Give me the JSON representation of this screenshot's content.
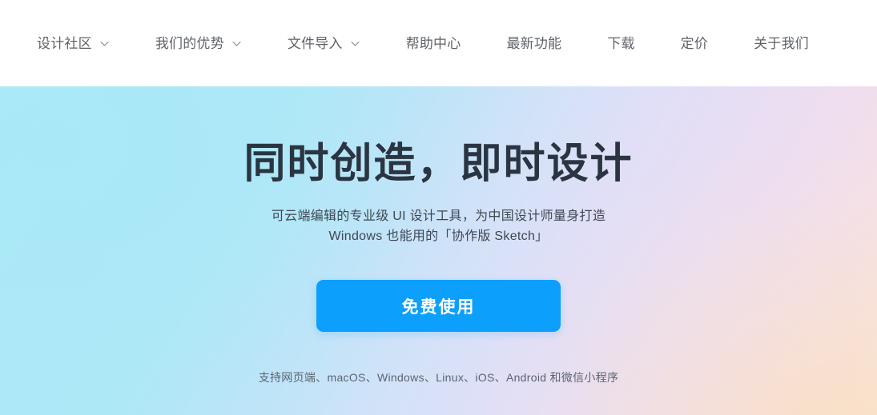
{
  "nav": {
    "items": [
      {
        "label": "设计社区",
        "has_dropdown": true,
        "icon": "chevron-down-icon",
        "name": "design-community"
      },
      {
        "label": "我们的优势",
        "has_dropdown": true,
        "icon": "chevron-down-icon",
        "name": "our-advantages"
      },
      {
        "label": "文件导入",
        "has_dropdown": true,
        "icon": "chevron-down-icon",
        "name": "file-import"
      },
      {
        "label": "帮助中心",
        "has_dropdown": false,
        "icon": "",
        "name": "help-center"
      },
      {
        "label": "最新功能",
        "has_dropdown": false,
        "icon": "",
        "name": "latest-features"
      },
      {
        "label": "下载",
        "has_dropdown": false,
        "icon": "",
        "name": "download"
      },
      {
        "label": "定价",
        "has_dropdown": false,
        "icon": "",
        "name": "pricing"
      },
      {
        "label": "关于我们",
        "has_dropdown": false,
        "icon": "",
        "name": "about-us"
      }
    ]
  },
  "hero": {
    "title": "同时创造，即时设计",
    "subtitle_line1": "可云端编辑的专业级 UI 设计工具，为中国设计师量身打造",
    "subtitle_line2": "Windows 也能用的「协作版 Sketch」",
    "cta_label": "免费使用",
    "platform_note": "支持网页端、macOS、Windows、Linux、iOS、Android 和微信小程序"
  },
  "colors": {
    "navbar_background": "#ffffff",
    "nav_text": "#5f6368",
    "hero_gradient_start": "#abe9f7",
    "hero_gradient_mid": "#e0dff7",
    "hero_gradient_end": "#f9e7d8",
    "title_text": "#2b3542",
    "subtitle_text": "#3f4753",
    "cta_background": "#0c9ffb",
    "cta_text": "#ffffff",
    "platform_note_text": "#5c6472"
  }
}
